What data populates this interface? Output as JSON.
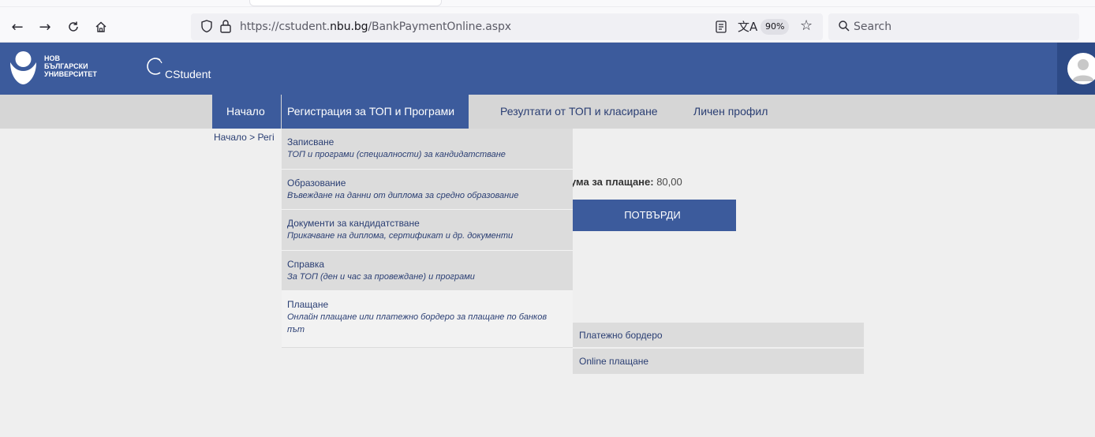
{
  "browser": {
    "url_prefix": "https://cstudent.",
    "url_domain": "nbu.bg",
    "url_path": "/BankPaymentOnline.aspx",
    "zoom": "90%",
    "search_placeholder": "Search"
  },
  "header": {
    "logo_line1": "НОВ",
    "logo_line2": "БЪЛГАРСКИ",
    "logo_line3": "УНИВЕРСИТЕТ",
    "app_name": "CStudent"
  },
  "nav": {
    "home": "Начало",
    "registration": "Регистрация за ТОП и Програми",
    "results": "Резултати от ТОП и класиране",
    "profile": "Личен профил"
  },
  "breadcrumb": "Начало > Регі",
  "payment": {
    "sum_label": "ума за плащане:",
    "sum_value": " 80,00",
    "confirm_label": "ПОТВЪРДИ"
  },
  "dropdown": {
    "items": [
      {
        "title": "Записване",
        "subtitle": "ТОП и програми (специалности) за кандидатстване"
      },
      {
        "title": "Образование",
        "subtitle": "Въвеждане на данни от диплома за средно образование"
      },
      {
        "title": "Документи за кандидатстване",
        "subtitle": "Прикачване на диплома, сертификат и др. документи"
      },
      {
        "title": "Справка",
        "subtitle": "За ТОП (ден и час за провеждане) и програми"
      },
      {
        "title": "Плащане",
        "subtitle": "Онлайн плащане или платежно бордеро за плащане по банков път"
      }
    ]
  },
  "submenu": {
    "items": [
      "Платежно бордеро",
      "Online плащане"
    ]
  }
}
